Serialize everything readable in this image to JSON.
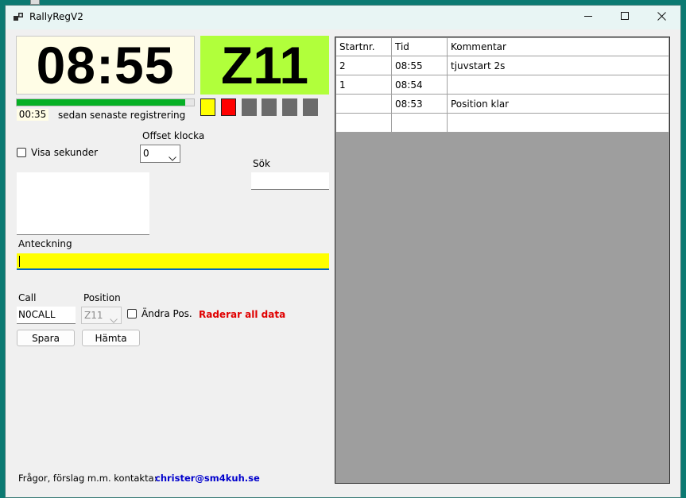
{
  "window": {
    "title": "RallyRegV2"
  },
  "clock": {
    "time": "08:55"
  },
  "position_display": {
    "code": "Z11"
  },
  "progress": {
    "fraction": 0.95,
    "color": "#06b025"
  },
  "elapsed": {
    "value": "00:35",
    "label": "sedan senaste registrering"
  },
  "status_squares": [
    {
      "color": "#ffff00"
    },
    {
      "color": "#ff0000"
    },
    {
      "color": "#6b6b6b"
    },
    {
      "color": "#6b6b6b"
    },
    {
      "color": "#6b6b6b"
    },
    {
      "color": "#6b6b6b"
    }
  ],
  "show_seconds": {
    "label": "Visa sekunder",
    "checked": false
  },
  "offset": {
    "label": "Offset klocka",
    "value": "0"
  },
  "search": {
    "label": "Sök",
    "value": ""
  },
  "note": {
    "label": "Anteckning",
    "value": "",
    "background": "#ffff00"
  },
  "call": {
    "label": "Call",
    "value": "N0CALL"
  },
  "position": {
    "label": "Position",
    "value": "Z11",
    "change_label": "Ändra Pos.",
    "change_checked": false
  },
  "warning": {
    "text": "Raderar all data",
    "color": "#e00000"
  },
  "buttons": {
    "save": "Spara",
    "fetch": "Hämta"
  },
  "footer": {
    "label": "Frågor, förslag m.m. kontakta:",
    "email": "christer@sm4kuh.se"
  },
  "log": {
    "columns": [
      "Startnr.",
      "Tid",
      "Kommentar"
    ],
    "rows": [
      [
        "2",
        "08:55",
        "tjuvstart 2s"
      ],
      [
        "1",
        "08:54",
        ""
      ],
      [
        "",
        "08:53",
        "Position klar"
      ],
      [
        "",
        "",
        ""
      ]
    ]
  }
}
